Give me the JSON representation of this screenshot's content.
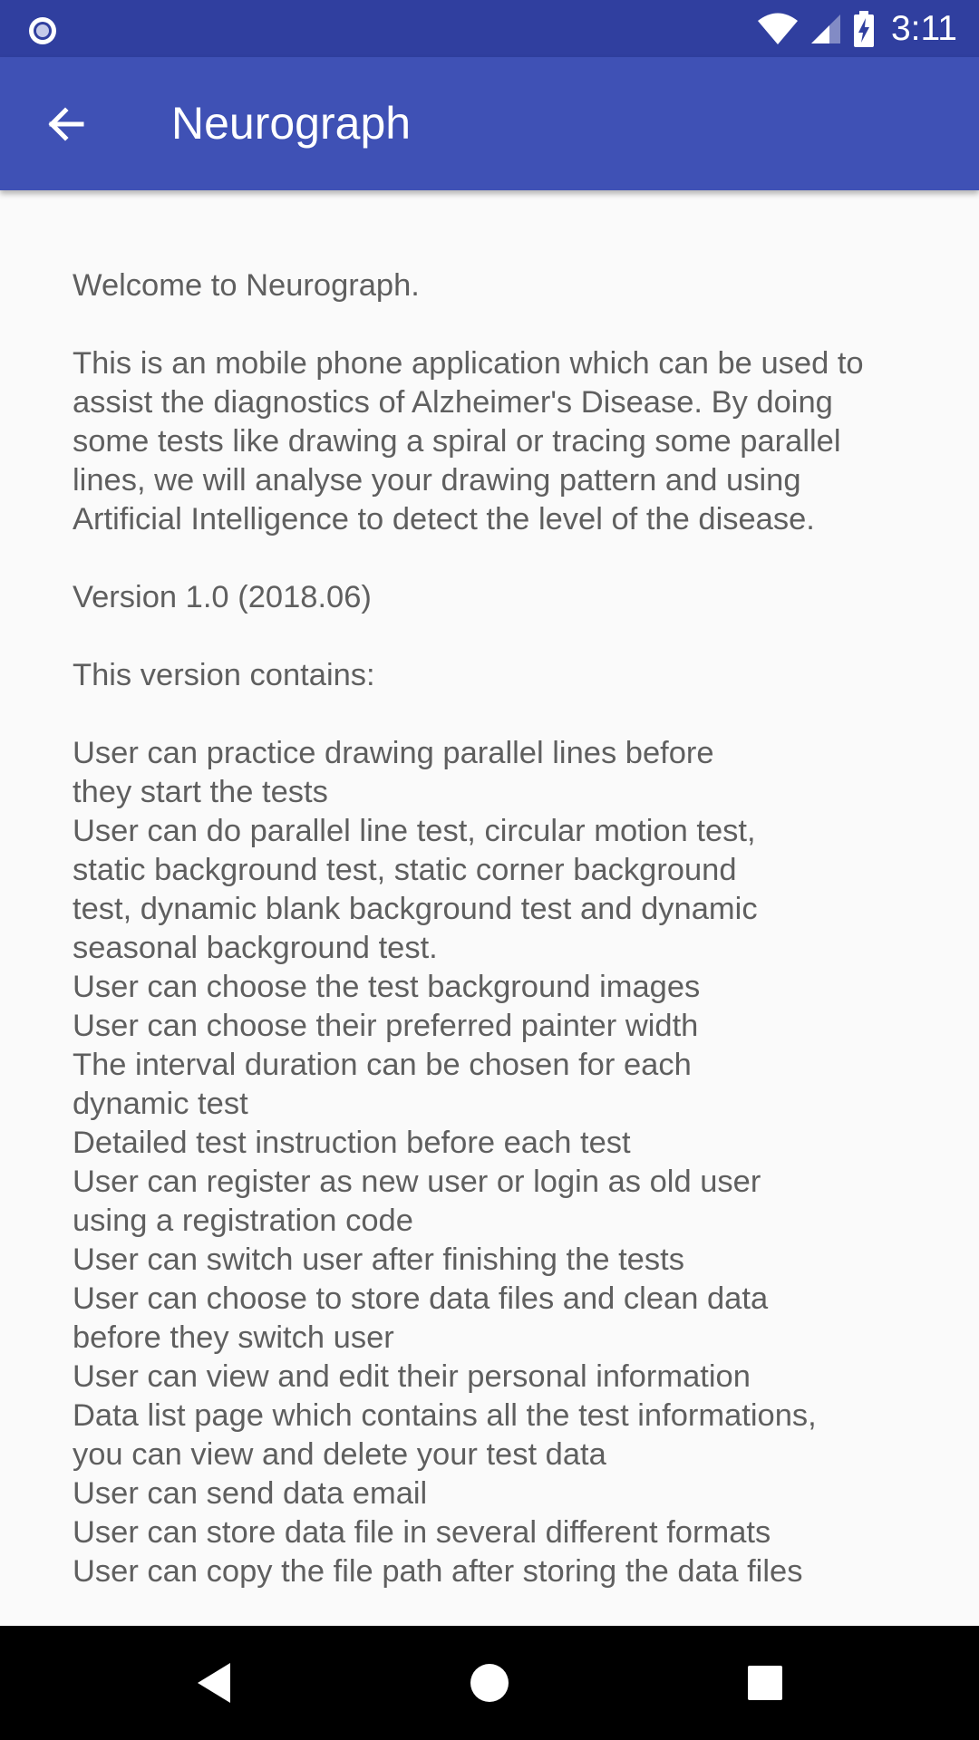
{
  "status_bar": {
    "time": "3:11",
    "icons": [
      "notification-dot-icon",
      "wifi-icon",
      "cell-signal-icon",
      "battery-charging-icon"
    ]
  },
  "app_bar": {
    "title": "Neurograph",
    "back_icon": "arrow-back-icon"
  },
  "content": {
    "text": "Welcome to Neurograph.\n\nThis is an mobile phone application which can be used to assist the diagnostics of Alzheimer's Disease. By doing some tests like drawing a spiral or tracing some parallel lines, we will analyse your drawing pattern and using Artificial Intelligence to detect the level of the disease.\n\nVersion 1.0 (2018.06)\n\nThis version contains:\n\nUser can practice drawing parallel lines before\nthey start the tests\nUser can do parallel line test, circular motion test,\nstatic background test, static corner background\ntest, dynamic blank background test and dynamic\nseasonal background test.\nUser can choose the test background images\nUser can choose their preferred painter width\nThe interval duration can be chosen for each\ndynamic test\nDetailed test instruction before each test\nUser can register as new user or login as old user\nusing a registration code\nUser can switch user after finishing the tests\nUser can choose to store data files and clean data\nbefore they switch user\nUser can view and edit their personal information\nData list page which contains all the test informations,\nyou can view and delete your test data\nUser can send data email\nUser can store data file in several different formats\nUser can copy the file path after storing the data files"
  },
  "nav_bar": {
    "icons": [
      "back-triangle-icon",
      "home-circle-icon",
      "recents-square-icon"
    ]
  },
  "colors": {
    "status_bar": "#303f9f",
    "app_bar": "#3f51b5",
    "background": "#fafafa",
    "text": "#5f5f5f",
    "nav_bar": "#000000"
  }
}
